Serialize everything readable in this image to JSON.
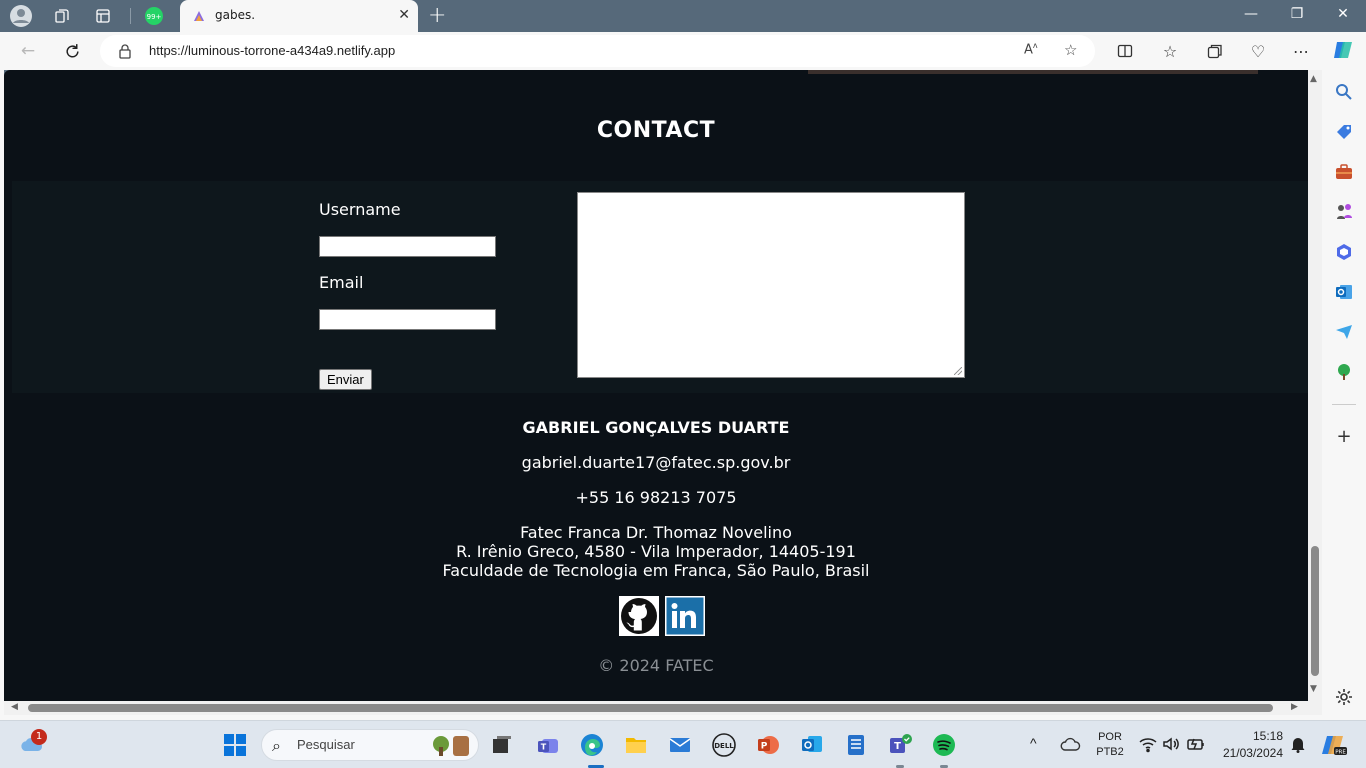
{
  "browser": {
    "tab_title": "gabes.",
    "url": "https://luminous-torrone-a434a9.netlify.app",
    "groups_badge": "99+"
  },
  "page": {
    "contact_title": "CONTACT",
    "form": {
      "username_label": "Username",
      "email_label": "Email",
      "submit_label": "Enviar",
      "username_value": "",
      "email_value": "",
      "message_value": ""
    },
    "footer": {
      "name": "GABRIEL GONÇALVES DUARTE",
      "email": "gabriel.duarte17@fatec.sp.gov.br",
      "phone": "+55 16 98213 7075",
      "address_line1": "Fatec Franca Dr. Thomaz Novelino",
      "address_line2": "R. Irênio Greco, 4580 - Vila Imperador, 14405-191",
      "address_line3": "Faculdade de Tecnologia em Franca, São Paulo, Brasil",
      "copyright": "© 2024 FATEC",
      "social": [
        "github-icon",
        "linkedin-icon"
      ]
    }
  },
  "taskbar": {
    "search_placeholder": "Pesquisar",
    "weather_badge": "1",
    "language": "POR",
    "layout": "PTB2",
    "time": "15:18",
    "date": "21/03/2024"
  },
  "colors": {
    "page_bg": "#0b1117",
    "contact_bg": "#0e171c",
    "accent_edge": "#0c59a4"
  }
}
